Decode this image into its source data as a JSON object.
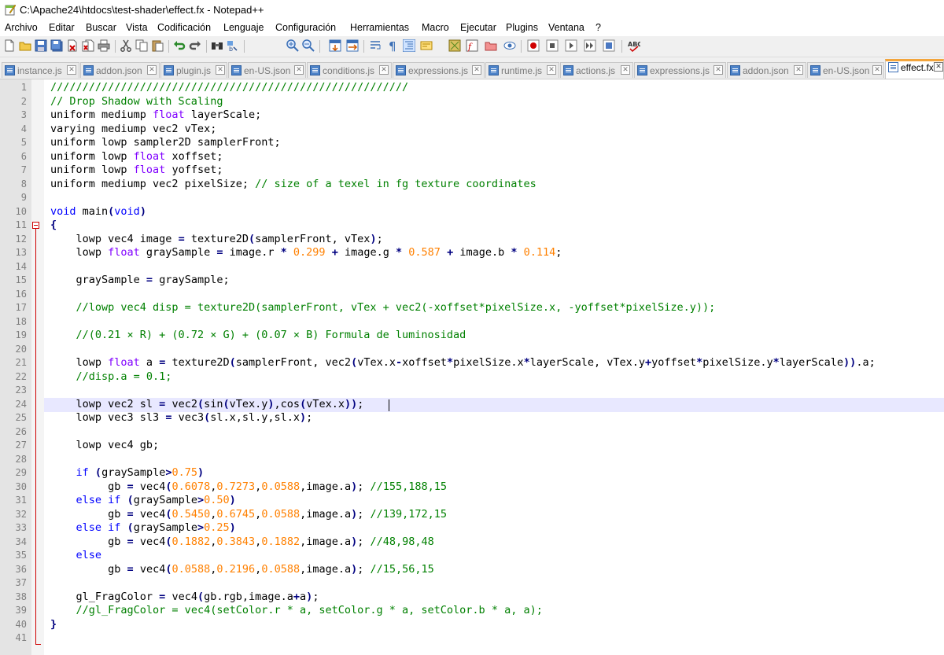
{
  "window": {
    "title": "C:\\Apache24\\htdocs\\test-shader\\effect.fx - Notepad++"
  },
  "menu": [
    "Archivo",
    "Editar",
    "Buscar",
    "Vista",
    "Codificación",
    "Lenguaje",
    "Configuración",
    "Herramientas",
    "Macro",
    "Ejecutar",
    "Plugins",
    "Ventana",
    "?"
  ],
  "tabs": [
    {
      "label": "instance.js",
      "active": false
    },
    {
      "label": "addon.json",
      "active": false
    },
    {
      "label": "plugin.js",
      "active": false
    },
    {
      "label": "en-US.json",
      "active": false
    },
    {
      "label": "conditions.js",
      "active": false
    },
    {
      "label": "expressions.js",
      "active": false
    },
    {
      "label": "runtime.js",
      "active": false
    },
    {
      "label": "actions.js",
      "active": false
    },
    {
      "label": "expressions.js",
      "active": false
    },
    {
      "label": "addon.json",
      "active": false
    },
    {
      "label": "en-US.json",
      "active": false
    },
    {
      "label": "effect.fx",
      "active": true
    }
  ],
  "tab_close_glyph": "✕",
  "toolbar_icons": [
    "new-file",
    "open-file",
    "save",
    "save-all",
    "close",
    "close-all",
    "print",
    "cut",
    "copy",
    "paste",
    "undo",
    "redo",
    "find",
    "replace",
    "zoom-in",
    "zoom-out",
    "sync-vertical",
    "sync-horizontal",
    "word-wrap",
    "show-all-chars",
    "indent-guide",
    "user-defined-lang",
    "doc-map",
    "function-list",
    "folder-workspace",
    "monitoring",
    "record-macro",
    "stop-macro",
    "play-macro",
    "run-macro-multiple",
    "save-macro",
    "spell-check"
  ],
  "colors": {
    "comment": "#008000",
    "type_keyword": "#8000ff",
    "keyword": "#0000ff",
    "number": "#ff8000",
    "operator": "#000080",
    "active_tab_accent": "#f3a53c",
    "fold_marker": "#ce0000",
    "current_line": "#e8e8ff"
  },
  "editor": {
    "current_line": 24,
    "lines": [
      {
        "n": "1",
        "tokens": [
          [
            "c",
            "////////////////////////////////////////////////////////"
          ]
        ]
      },
      {
        "n": "2",
        "tokens": [
          [
            "c",
            "// Drop Shadow with Scaling"
          ]
        ]
      },
      {
        "n": "3",
        "tokens": [
          [
            "",
            "uniform mediump "
          ],
          [
            "k",
            "float"
          ],
          [
            "",
            " layerScale;"
          ]
        ]
      },
      {
        "n": "4",
        "tokens": [
          [
            "",
            "varying mediump vec2 vTex;"
          ]
        ]
      },
      {
        "n": "5",
        "tokens": [
          [
            "",
            "uniform lowp sampler2D samplerFront;"
          ]
        ]
      },
      {
        "n": "6",
        "tokens": [
          [
            "",
            "uniform lowp "
          ],
          [
            "k",
            "float"
          ],
          [
            "",
            " xoffset;"
          ]
        ]
      },
      {
        "n": "7",
        "tokens": [
          [
            "",
            "uniform lowp "
          ],
          [
            "k",
            "float"
          ],
          [
            "",
            " yoffset;"
          ]
        ]
      },
      {
        "n": "8",
        "tokens": [
          [
            "",
            "uniform mediump vec2 pixelSize; "
          ],
          [
            "c",
            "// size of a texel in fg texture coordinates"
          ]
        ]
      },
      {
        "n": "9",
        "tokens": []
      },
      {
        "n": "10",
        "tokens": [
          [
            "kw",
            "void"
          ],
          [
            "",
            " main"
          ],
          [
            "o",
            "("
          ],
          [
            "kw",
            "void"
          ],
          [
            "o",
            ")"
          ]
        ]
      },
      {
        "n": "11",
        "tokens": [
          [
            "o",
            "{"
          ]
        ]
      },
      {
        "n": "12",
        "tokens": [
          [
            "",
            "    lowp vec4 image "
          ],
          [
            "o",
            "="
          ],
          [
            "",
            " texture2D"
          ],
          [
            "o",
            "("
          ],
          [
            "",
            "samplerFront, vTex"
          ],
          [
            "o",
            ")"
          ],
          [
            "",
            ";"
          ]
        ]
      },
      {
        "n": "13",
        "tokens": [
          [
            "",
            "    lowp "
          ],
          [
            "k",
            "float"
          ],
          [
            "",
            " graySample "
          ],
          [
            "o",
            "="
          ],
          [
            "",
            " image.r "
          ],
          [
            "o",
            "*"
          ],
          [
            "",
            " "
          ],
          [
            "n",
            "0.299"
          ],
          [
            "",
            " "
          ],
          [
            "o",
            "+"
          ],
          [
            "",
            " image.g "
          ],
          [
            "o",
            "*"
          ],
          [
            "",
            " "
          ],
          [
            "n",
            "0.587"
          ],
          [
            "",
            " "
          ],
          [
            "o",
            "+"
          ],
          [
            "",
            " image.b "
          ],
          [
            "o",
            "*"
          ],
          [
            "",
            " "
          ],
          [
            "n",
            "0.114"
          ],
          [
            "",
            ";"
          ]
        ]
      },
      {
        "n": "14",
        "tokens": []
      },
      {
        "n": "15",
        "tokens": [
          [
            "",
            "    graySample "
          ],
          [
            "o",
            "="
          ],
          [
            "",
            " graySample;"
          ]
        ]
      },
      {
        "n": "16",
        "tokens": []
      },
      {
        "n": "17",
        "tokens": [
          [
            "",
            "    "
          ],
          [
            "c",
            "//lowp vec4 disp = texture2D(samplerFront, vTex + vec2(-xoffset*pixelSize.x, -yoffset*pixelSize.y));"
          ]
        ]
      },
      {
        "n": "18",
        "tokens": []
      },
      {
        "n": "19",
        "tokens": [
          [
            "",
            "    "
          ],
          [
            "c",
            "//(0.21 × R) + (0.72 × G) + (0.07 × B) Formula de luminosidad"
          ]
        ]
      },
      {
        "n": "20",
        "tokens": []
      },
      {
        "n": "21",
        "tokens": [
          [
            "",
            "    lowp "
          ],
          [
            "k",
            "float"
          ],
          [
            "",
            " a "
          ],
          [
            "o",
            "="
          ],
          [
            "",
            " texture2D"
          ],
          [
            "o",
            "("
          ],
          [
            "",
            "samplerFront, vec2"
          ],
          [
            "o",
            "("
          ],
          [
            "",
            "vTex.x"
          ],
          [
            "o",
            "-"
          ],
          [
            "",
            "xoffset"
          ],
          [
            "o",
            "*"
          ],
          [
            "",
            "pixelSize.x"
          ],
          [
            "o",
            "*"
          ],
          [
            "",
            "layerScale, vTex.y"
          ],
          [
            "o",
            "+"
          ],
          [
            "",
            "yoffset"
          ],
          [
            "o",
            "*"
          ],
          [
            "",
            "pixelSize.y"
          ],
          [
            "o",
            "*"
          ],
          [
            "",
            "layerScale"
          ],
          [
            "o",
            "))"
          ],
          [
            "",
            ".a;"
          ]
        ]
      },
      {
        "n": "22",
        "tokens": [
          [
            "",
            "    "
          ],
          [
            "c",
            "//disp.a = 0.1;"
          ]
        ]
      },
      {
        "n": "23",
        "tokens": []
      },
      {
        "n": "24",
        "tokens": [
          [
            "",
            "    lowp vec2 sl "
          ],
          [
            "o",
            "="
          ],
          [
            "",
            " vec2"
          ],
          [
            "o",
            "("
          ],
          [
            "",
            "sin"
          ],
          [
            "o",
            "("
          ],
          [
            "",
            "vTex.y"
          ],
          [
            "o",
            ")"
          ],
          [
            "",
            ",cos"
          ],
          [
            "o",
            "("
          ],
          [
            "",
            "vTex.x"
          ],
          [
            "o",
            "))"
          ],
          [
            "",
            ";"
          ]
        ]
      },
      {
        "n": "25",
        "tokens": [
          [
            "",
            "    lowp vec3 sl3 "
          ],
          [
            "o",
            "="
          ],
          [
            "",
            " vec3"
          ],
          [
            "o",
            "("
          ],
          [
            "",
            "sl.x,sl.y,sl.x"
          ],
          [
            "o",
            ")"
          ],
          [
            "",
            ";"
          ]
        ]
      },
      {
        "n": "26",
        "tokens": []
      },
      {
        "n": "27",
        "tokens": [
          [
            "",
            "    lowp vec4 gb;"
          ]
        ]
      },
      {
        "n": "28",
        "tokens": []
      },
      {
        "n": "29",
        "tokens": [
          [
            "",
            "    "
          ],
          [
            "kw",
            "if"
          ],
          [
            "",
            " "
          ],
          [
            "o",
            "("
          ],
          [
            "",
            "graySample"
          ],
          [
            "o",
            ">"
          ],
          [
            "n",
            "0.75"
          ],
          [
            "o",
            ")"
          ]
        ]
      },
      {
        "n": "30",
        "tokens": [
          [
            "",
            "         gb "
          ],
          [
            "o",
            "="
          ],
          [
            "",
            " vec4"
          ],
          [
            "o",
            "("
          ],
          [
            "n",
            "0.6078"
          ],
          [
            "",
            ","
          ],
          [
            "n",
            "0.7273"
          ],
          [
            "",
            ","
          ],
          [
            "n",
            "0.0588"
          ],
          [
            "",
            ",image.a"
          ],
          [
            "o",
            ")"
          ],
          [
            "",
            "; "
          ],
          [
            "c",
            "//155,188,15"
          ]
        ]
      },
      {
        "n": "31",
        "tokens": [
          [
            "",
            "    "
          ],
          [
            "kw",
            "else"
          ],
          [
            "",
            " "
          ],
          [
            "kw",
            "if"
          ],
          [
            "",
            " "
          ],
          [
            "o",
            "("
          ],
          [
            "",
            "graySample"
          ],
          [
            "o",
            ">"
          ],
          [
            "n",
            "0.50"
          ],
          [
            "o",
            ")"
          ]
        ]
      },
      {
        "n": "32",
        "tokens": [
          [
            "",
            "         gb "
          ],
          [
            "o",
            "="
          ],
          [
            "",
            " vec4"
          ],
          [
            "o",
            "("
          ],
          [
            "n",
            "0.5450"
          ],
          [
            "",
            ","
          ],
          [
            "n",
            "0.6745"
          ],
          [
            "",
            ","
          ],
          [
            "n",
            "0.0588"
          ],
          [
            "",
            ",image.a"
          ],
          [
            "o",
            ")"
          ],
          [
            "",
            "; "
          ],
          [
            "c",
            "//139,172,15"
          ]
        ]
      },
      {
        "n": "33",
        "tokens": [
          [
            "",
            "    "
          ],
          [
            "kw",
            "else"
          ],
          [
            "",
            " "
          ],
          [
            "kw",
            "if"
          ],
          [
            "",
            " "
          ],
          [
            "o",
            "("
          ],
          [
            "",
            "graySample"
          ],
          [
            "o",
            ">"
          ],
          [
            "n",
            "0.25"
          ],
          [
            "o",
            ")"
          ]
        ]
      },
      {
        "n": "34",
        "tokens": [
          [
            "",
            "         gb "
          ],
          [
            "o",
            "="
          ],
          [
            "",
            " vec4"
          ],
          [
            "o",
            "("
          ],
          [
            "n",
            "0.1882"
          ],
          [
            "",
            ","
          ],
          [
            "n",
            "0.3843"
          ],
          [
            "",
            ","
          ],
          [
            "n",
            "0.1882"
          ],
          [
            "",
            ",image.a"
          ],
          [
            "o",
            ")"
          ],
          [
            "",
            "; "
          ],
          [
            "c",
            "//48,98,48"
          ]
        ]
      },
      {
        "n": "35",
        "tokens": [
          [
            "",
            "    "
          ],
          [
            "kw",
            "else"
          ]
        ]
      },
      {
        "n": "36",
        "tokens": [
          [
            "",
            "         gb "
          ],
          [
            "o",
            "="
          ],
          [
            "",
            " vec4"
          ],
          [
            "o",
            "("
          ],
          [
            "n",
            "0.0588"
          ],
          [
            "",
            ","
          ],
          [
            "n",
            "0.2196"
          ],
          [
            "",
            ","
          ],
          [
            "n",
            "0.0588"
          ],
          [
            "",
            ",image.a"
          ],
          [
            "o",
            ")"
          ],
          [
            "",
            "; "
          ],
          [
            "c",
            "//15,56,15"
          ]
        ]
      },
      {
        "n": "37",
        "tokens": []
      },
      {
        "n": "38",
        "tokens": [
          [
            "",
            "    gl_FragColor "
          ],
          [
            "o",
            "="
          ],
          [
            "",
            " vec4"
          ],
          [
            "o",
            "("
          ],
          [
            "",
            "gb.rgb,image.a"
          ],
          [
            "o",
            "+"
          ],
          [
            "",
            "a"
          ],
          [
            "o",
            ")"
          ],
          [
            "",
            ";"
          ]
        ]
      },
      {
        "n": "39",
        "tokens": [
          [
            "",
            "    "
          ],
          [
            "c",
            "//gl_FragColor = vec4(setColor.r * a, setColor.g * a, setColor.b * a, a);"
          ]
        ]
      },
      {
        "n": "40",
        "tokens": [
          [
            "o",
            "}"
          ]
        ]
      },
      {
        "n": "41",
        "tokens": []
      }
    ]
  }
}
